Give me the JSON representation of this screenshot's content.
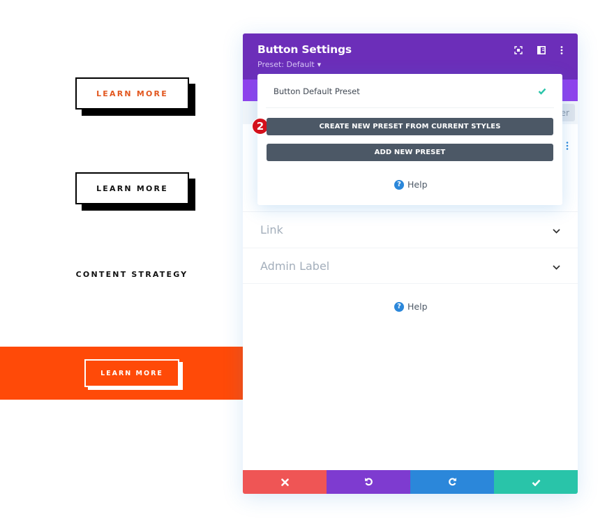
{
  "preview": {
    "button_1_label": "LEARN MORE",
    "button_2_label": "LEARN MORE",
    "content_strategy_label": "CONTENT STRATEGY",
    "button_3_label": "LEARN MORE",
    "colors": {
      "button_1_text": "#e2571f",
      "orange_band": "#ff4a08"
    }
  },
  "modal": {
    "title": "Button Settings",
    "preset_label": "Preset: Default",
    "header_icons": [
      "expand-icon",
      "sidebar-layout-icon",
      "more-vertical-icon"
    ],
    "filter_partial_text": "er",
    "sections": [
      {
        "label": "Link"
      },
      {
        "label": "Admin Label"
      }
    ],
    "help_label": "Help",
    "footer": {
      "cancel": "close-icon",
      "undo": "undo-icon",
      "redo": "redo-icon",
      "save": "check-icon"
    },
    "colors": {
      "header": "#6c2eb9",
      "tab_strip": "#8f42ec",
      "cancel": "#ef5555",
      "undo": "#7e3bd0",
      "redo": "#2b87da",
      "save": "#29c4a9"
    }
  },
  "preset_dropdown": {
    "items": [
      {
        "label": "Button Default Preset",
        "selected": true
      }
    ],
    "create_button_label": "CREATE NEW PRESET FROM CURRENT STYLES",
    "add_button_label": "ADD NEW PRESET",
    "help_label": "Help",
    "step_badge": "2"
  }
}
